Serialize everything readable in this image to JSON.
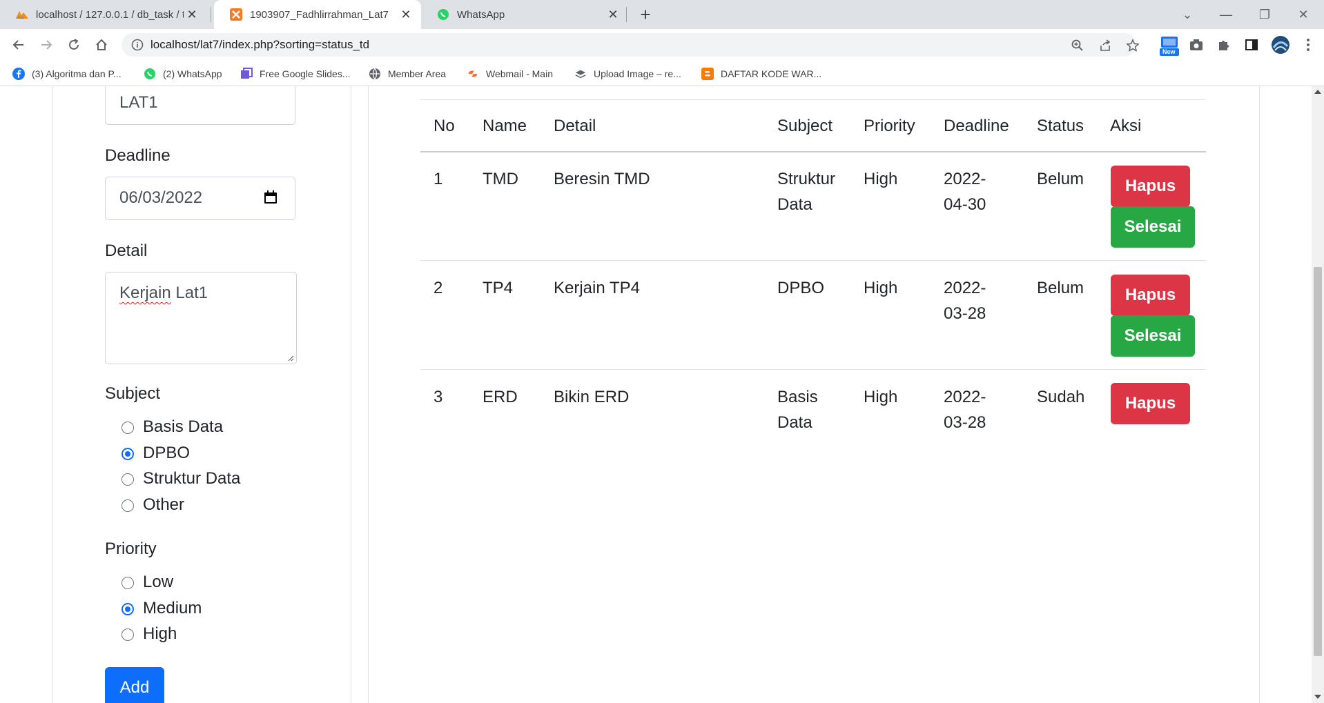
{
  "browser": {
    "tabs": [
      {
        "title": "localhost / 127.0.0.1 / db_task / t",
        "favicon": "phpmyadmin-icon",
        "active": false
      },
      {
        "title": "1903907_Fadhlirrahman_Lat7",
        "favicon": "xampp-icon",
        "active": true
      },
      {
        "title": "WhatsApp",
        "favicon": "whatsapp-icon",
        "active": false
      }
    ],
    "url": "localhost/lat7/index.php?sorting=status_td",
    "bookmarks": [
      {
        "label": "(3) Algoritma dan P...",
        "icon": "facebook-icon"
      },
      {
        "label": "(2) WhatsApp",
        "icon": "whatsapp-icon"
      },
      {
        "label": "Free Google Slides...",
        "icon": "slides-icon"
      },
      {
        "label": "Member Area",
        "icon": "globe-icon"
      },
      {
        "label": "Webmail - Main",
        "icon": "cpanel-icon"
      },
      {
        "label": "Upload Image – re...",
        "icon": "layers-icon"
      },
      {
        "label": "DAFTAR KODE WAR...",
        "icon": "blogger-icon"
      }
    ],
    "extension_badge": "New"
  },
  "form": {
    "name_value": "LAT1",
    "deadline_label": "Deadline",
    "deadline_value": "06/03/2022",
    "detail_label": "Detail",
    "detail_value_misspelled": "Kerjain",
    "detail_value_rest": " Lat1",
    "subject_label": "Subject",
    "subject_options": [
      "Basis Data",
      "DPBO",
      "Struktur Data",
      "Other"
    ],
    "subject_selected": "DPBO",
    "priority_label": "Priority",
    "priority_options": [
      "Low",
      "Medium",
      "High"
    ],
    "priority_selected": "Medium",
    "add_label": "Add"
  },
  "table": {
    "headers": [
      "No",
      "Name",
      "Detail",
      "Subject",
      "Priority",
      "Deadline",
      "Status",
      "Aksi"
    ],
    "rows": [
      {
        "no": "1",
        "name": "TMD",
        "detail": "Beresin TMD",
        "subject_l1": "Struktur",
        "subject_l2": "Data",
        "priority": "High",
        "deadline_l1": "2022-",
        "deadline_l2": "04-30",
        "status": "Belum",
        "actions": [
          "Hapus",
          "Selesai"
        ]
      },
      {
        "no": "2",
        "name": "TP4",
        "detail": "Kerjain TP4",
        "subject_l1": "DPBO",
        "subject_l2": "",
        "priority": "High",
        "deadline_l1": "2022-",
        "deadline_l2": "03-28",
        "status": "Belum",
        "actions": [
          "Hapus",
          "Selesai"
        ]
      },
      {
        "no": "3",
        "name": "ERD",
        "detail": "Bikin ERD",
        "subject_l1": "Basis",
        "subject_l2": "Data",
        "priority": "High",
        "deadline_l1": "2022-",
        "deadline_l2": "03-28",
        "status": "Sudah",
        "actions": [
          "Hapus"
        ]
      }
    ]
  },
  "colors": {
    "danger": "#dc3545",
    "success": "#28a745",
    "primary": "#0d6efd"
  }
}
